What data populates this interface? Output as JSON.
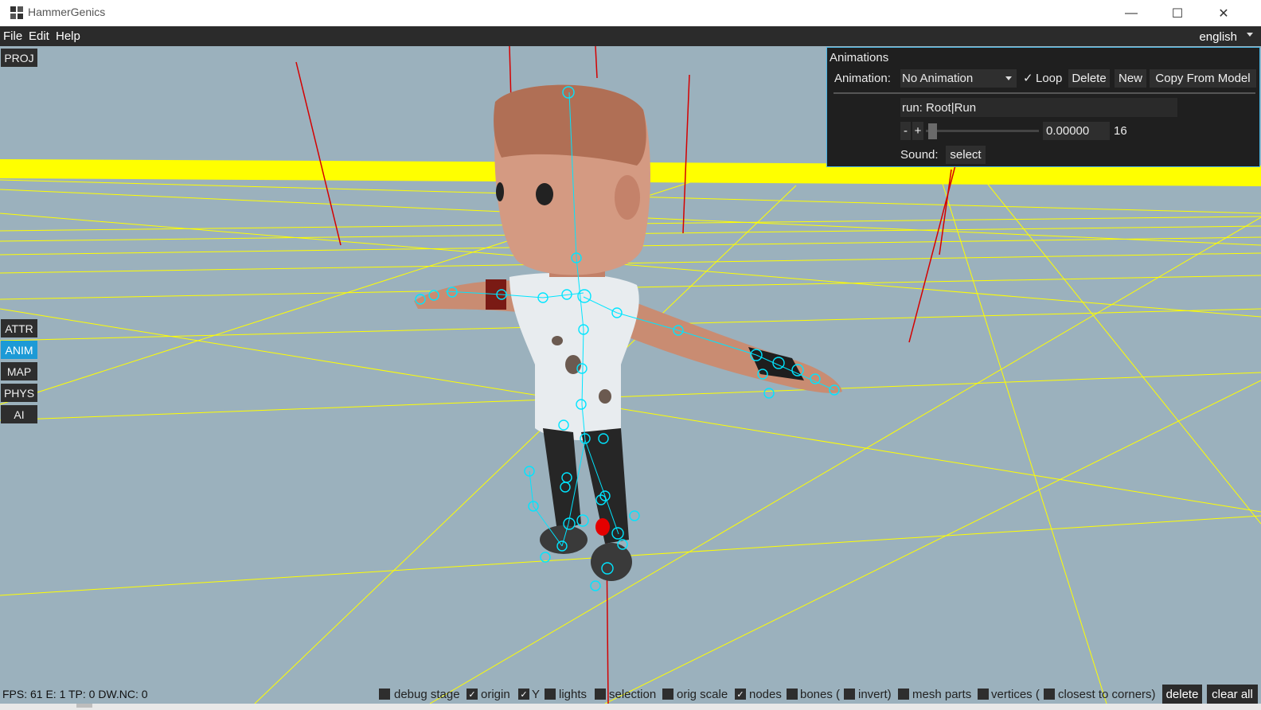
{
  "window": {
    "title": "HammerGenics",
    "minimize": "—",
    "maximize": "☐",
    "close": "✕"
  },
  "menu": {
    "items": [
      "File",
      "Edit",
      "Help"
    ],
    "language": "english"
  },
  "side_buttons": {
    "proj": "PROJ",
    "attr": "ATTR",
    "anim": "ANIM",
    "map": "MAP",
    "phys": "PHYS",
    "ai": "AI",
    "active": "ANIM"
  },
  "animations_panel": {
    "title": "Animations",
    "animation_label": "Animation:",
    "animation_value": "No Animation",
    "loop_check": "✓",
    "loop_label": "Loop",
    "delete_label": "Delete",
    "new_label": "New",
    "copy_label": "Copy From Model",
    "clip_name": "run: Root|Run",
    "minus": "-",
    "plus": "+",
    "time_value": "0.00000",
    "frame_count": "16",
    "sound_label": "Sound:",
    "sound_button": "select"
  },
  "status": {
    "fps_text": "FPS: 61 E: 1 TP: 0 DW.NC: 0",
    "options": [
      {
        "label": "debug stage",
        "checked": false
      },
      {
        "label": "origin",
        "checked": true
      },
      {
        "label": "Y",
        "checked": true
      },
      {
        "label": "lights",
        "checked": false
      },
      {
        "label": "selection",
        "checked": false
      },
      {
        "label": "orig scale",
        "checked": false
      },
      {
        "label": "nodes",
        "checked": true
      },
      {
        "label": "bones (",
        "checked": false
      },
      {
        "label": "invert)",
        "checked": false
      },
      {
        "label": "mesh parts",
        "checked": false
      },
      {
        "label": "vertices (",
        "checked": false
      },
      {
        "label": "closest to corners)",
        "checked": false
      }
    ],
    "check_mark": "✓",
    "delete_label": "delete",
    "clear_all_label": "clear all"
  },
  "colors": {
    "viewport_bg": "#9bb1bd",
    "grid": "#ffff00",
    "axis": "#e00000",
    "bone": "#00e5ff",
    "accent": "#1d9ad6"
  }
}
